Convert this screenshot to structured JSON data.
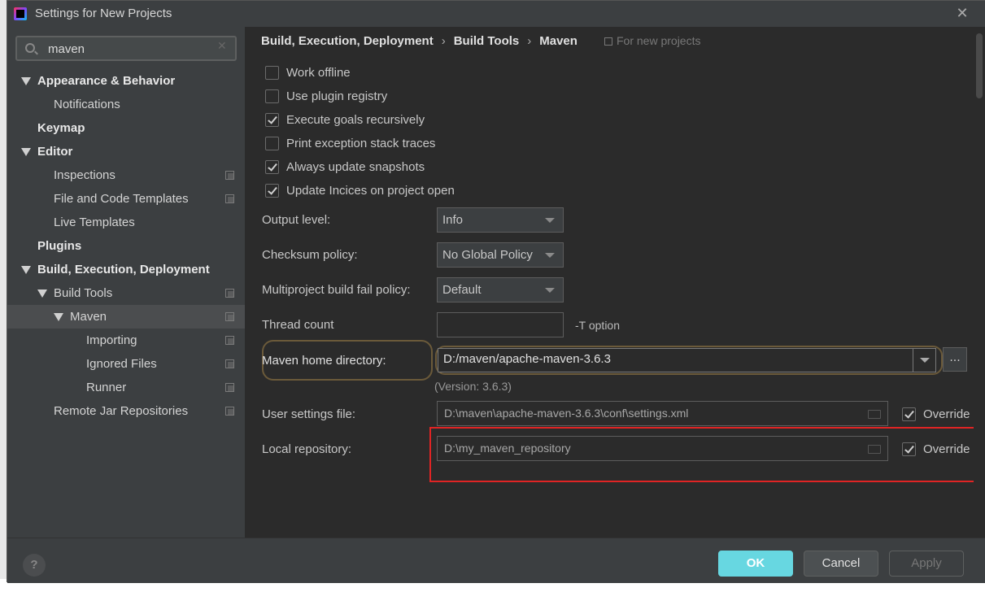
{
  "window": {
    "title": "Settings for New Projects"
  },
  "search": {
    "value": "maven"
  },
  "sidebar": {
    "items": [
      {
        "label": "Appearance & Behavior"
      },
      {
        "label": "Notifications"
      },
      {
        "label": "Keymap"
      },
      {
        "label": "Editor"
      },
      {
        "label": "Inspections"
      },
      {
        "label": "File and Code Templates"
      },
      {
        "label": "Live Templates"
      },
      {
        "label": "Plugins"
      },
      {
        "label": "Build, Execution, Deployment"
      },
      {
        "label": "Build Tools"
      },
      {
        "label": "Maven"
      },
      {
        "label": "Importing"
      },
      {
        "label": "Ignored Files"
      },
      {
        "label": "Runner"
      },
      {
        "label": "Remote Jar Repositories"
      }
    ]
  },
  "breadcrumb": {
    "items": [
      "Build, Execution, Deployment",
      "Build Tools",
      "Maven"
    ],
    "sep": "›",
    "note": "For new projects"
  },
  "checkboxes": [
    {
      "label": "Work offline",
      "checked": false
    },
    {
      "label": "Use plugin registry",
      "checked": false
    },
    {
      "label": "Execute goals recursively",
      "checked": true
    },
    {
      "label": "Print exception stack traces",
      "checked": false
    },
    {
      "label": "Always update snapshots",
      "checked": true
    },
    {
      "label": "Update Incices on project open",
      "checked": true
    }
  ],
  "fields": {
    "output_level": {
      "label": "Output level:",
      "value": "Info"
    },
    "checksum_policy": {
      "label": "Checksum policy:",
      "value": "No Global Policy"
    },
    "multiproject": {
      "label": "Multiproject build fail policy:",
      "value": "Default"
    },
    "thread_count": {
      "label": "Thread count",
      "value": "",
      "hint": "-T option"
    },
    "maven_home": {
      "label": "Maven home directory:",
      "value": "D:/maven/apache-maven-3.6.3",
      "browse": "...",
      "version": "(Version: 3.6.3)"
    },
    "user_settings": {
      "label": "User settings file:",
      "value": "D:\\maven\\apache-maven-3.6.3\\conf\\settings.xml",
      "override_label": "Override",
      "override_checked": true
    },
    "local_repo": {
      "label": "Local repository:",
      "value": "D:\\my_maven_repository",
      "override_label": "Override",
      "override_checked": true
    }
  },
  "footer": {
    "help": "?",
    "ok": "OK",
    "cancel": "Cancel",
    "apply": "Apply"
  },
  "colors": {
    "accent_ok": "#67d7e1",
    "highlight_red": "#e02424",
    "background": "#2b2b2b",
    "panel": "#3c3f41"
  }
}
